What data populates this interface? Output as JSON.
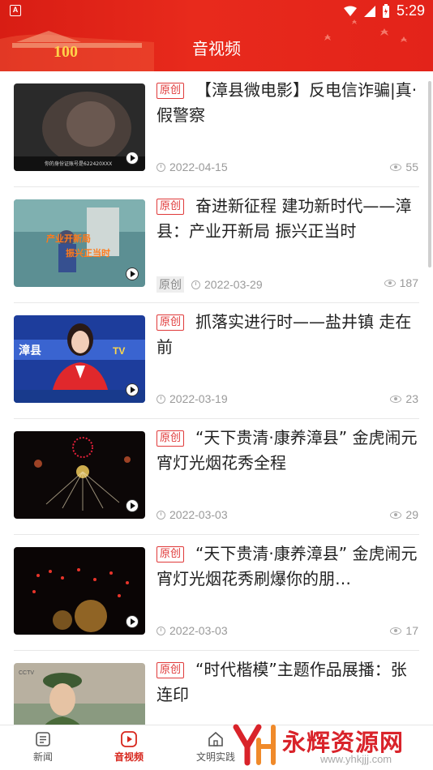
{
  "status": {
    "time": "5:29"
  },
  "header": {
    "title": "音视频"
  },
  "items": [
    {
      "badge": "原创",
      "title": "【漳县微电影】反电信诈骗|真·假警察",
      "date": "2022-04-15",
      "views": "55",
      "thumb_caption": "你的身份证账号是622420XXX"
    },
    {
      "badge": "原创",
      "title": "奋进新征程  建功新时代——漳县：产业开新局  振兴正当时",
      "meta_badge": "原创",
      "date": "2022-03-29",
      "views": "187",
      "thumb_caption": "产业开新局 振兴正当时"
    },
    {
      "badge": "原创",
      "title": "抓落实进行时——盐井镇  走在前",
      "date": "2022-03-19",
      "views": "23",
      "thumb_caption": "漳县TV"
    },
    {
      "badge": "原创",
      "title": "“天下贵清·康养漳县”  金虎闹元宵灯光烟花秀全程",
      "date": "2022-03-03",
      "views": "29"
    },
    {
      "badge": "原创",
      "title": "“天下贵清·康养漳县”  金虎闹元宵灯光烟花秀刷爆你的朋…",
      "date": "2022-03-03",
      "views": "17"
    },
    {
      "badge": "原创",
      "title": "“时代楷模”主题作品展播：张连印",
      "date": "",
      "views": ""
    }
  ],
  "nav": {
    "tabs": [
      {
        "label": "新闻",
        "icon": "news-icon"
      },
      {
        "label": "音视频",
        "icon": "video-icon",
        "active": true
      },
      {
        "label": "文明实践",
        "icon": "home-icon"
      }
    ]
  },
  "watermark": {
    "text": "永辉资源网",
    "url": "www.yhkjjj.com"
  },
  "colors": {
    "brand_red": "#e3231a",
    "badge_red": "#e03a3a",
    "active_tab": "#d7261c"
  }
}
